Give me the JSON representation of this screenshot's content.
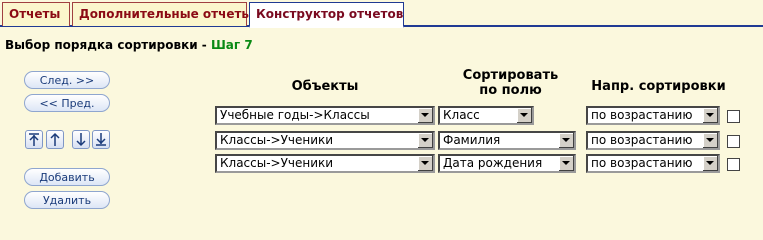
{
  "tabs": [
    {
      "label": "Отчеты"
    },
    {
      "label": "Дополнительные отчеты"
    },
    {
      "label": "Конструктор отчетов"
    }
  ],
  "heading": {
    "title": "Выбор порядка сортировки - ",
    "step": "Шаг 7"
  },
  "nav": {
    "next_label": "След. >>",
    "prev_label": "<< Пред.",
    "add_label": "Добавить",
    "delete_label": "Удалить"
  },
  "columns": {
    "objects": "Объекты",
    "sort_field_line1": "Сортировать",
    "sort_field_line2": "по полю",
    "direction": "Напр. сортировки"
  },
  "rows": [
    {
      "object": "Учебные годы->Классы",
      "field": "Класс",
      "direction": "по возрастанию",
      "checked": false
    },
    {
      "object": "Классы->Ученики",
      "field": "Фамилия",
      "direction": "по возрастанию",
      "checked": false
    },
    {
      "object": "Классы->Ученики",
      "field": "Дата рождения",
      "direction": "по возрастанию",
      "checked": false
    }
  ],
  "colors": {
    "background": "#fbf8dd",
    "tab_text": "#8b0a14",
    "step_accent": "#0a8a14",
    "button_text": "#1a3b7a"
  }
}
